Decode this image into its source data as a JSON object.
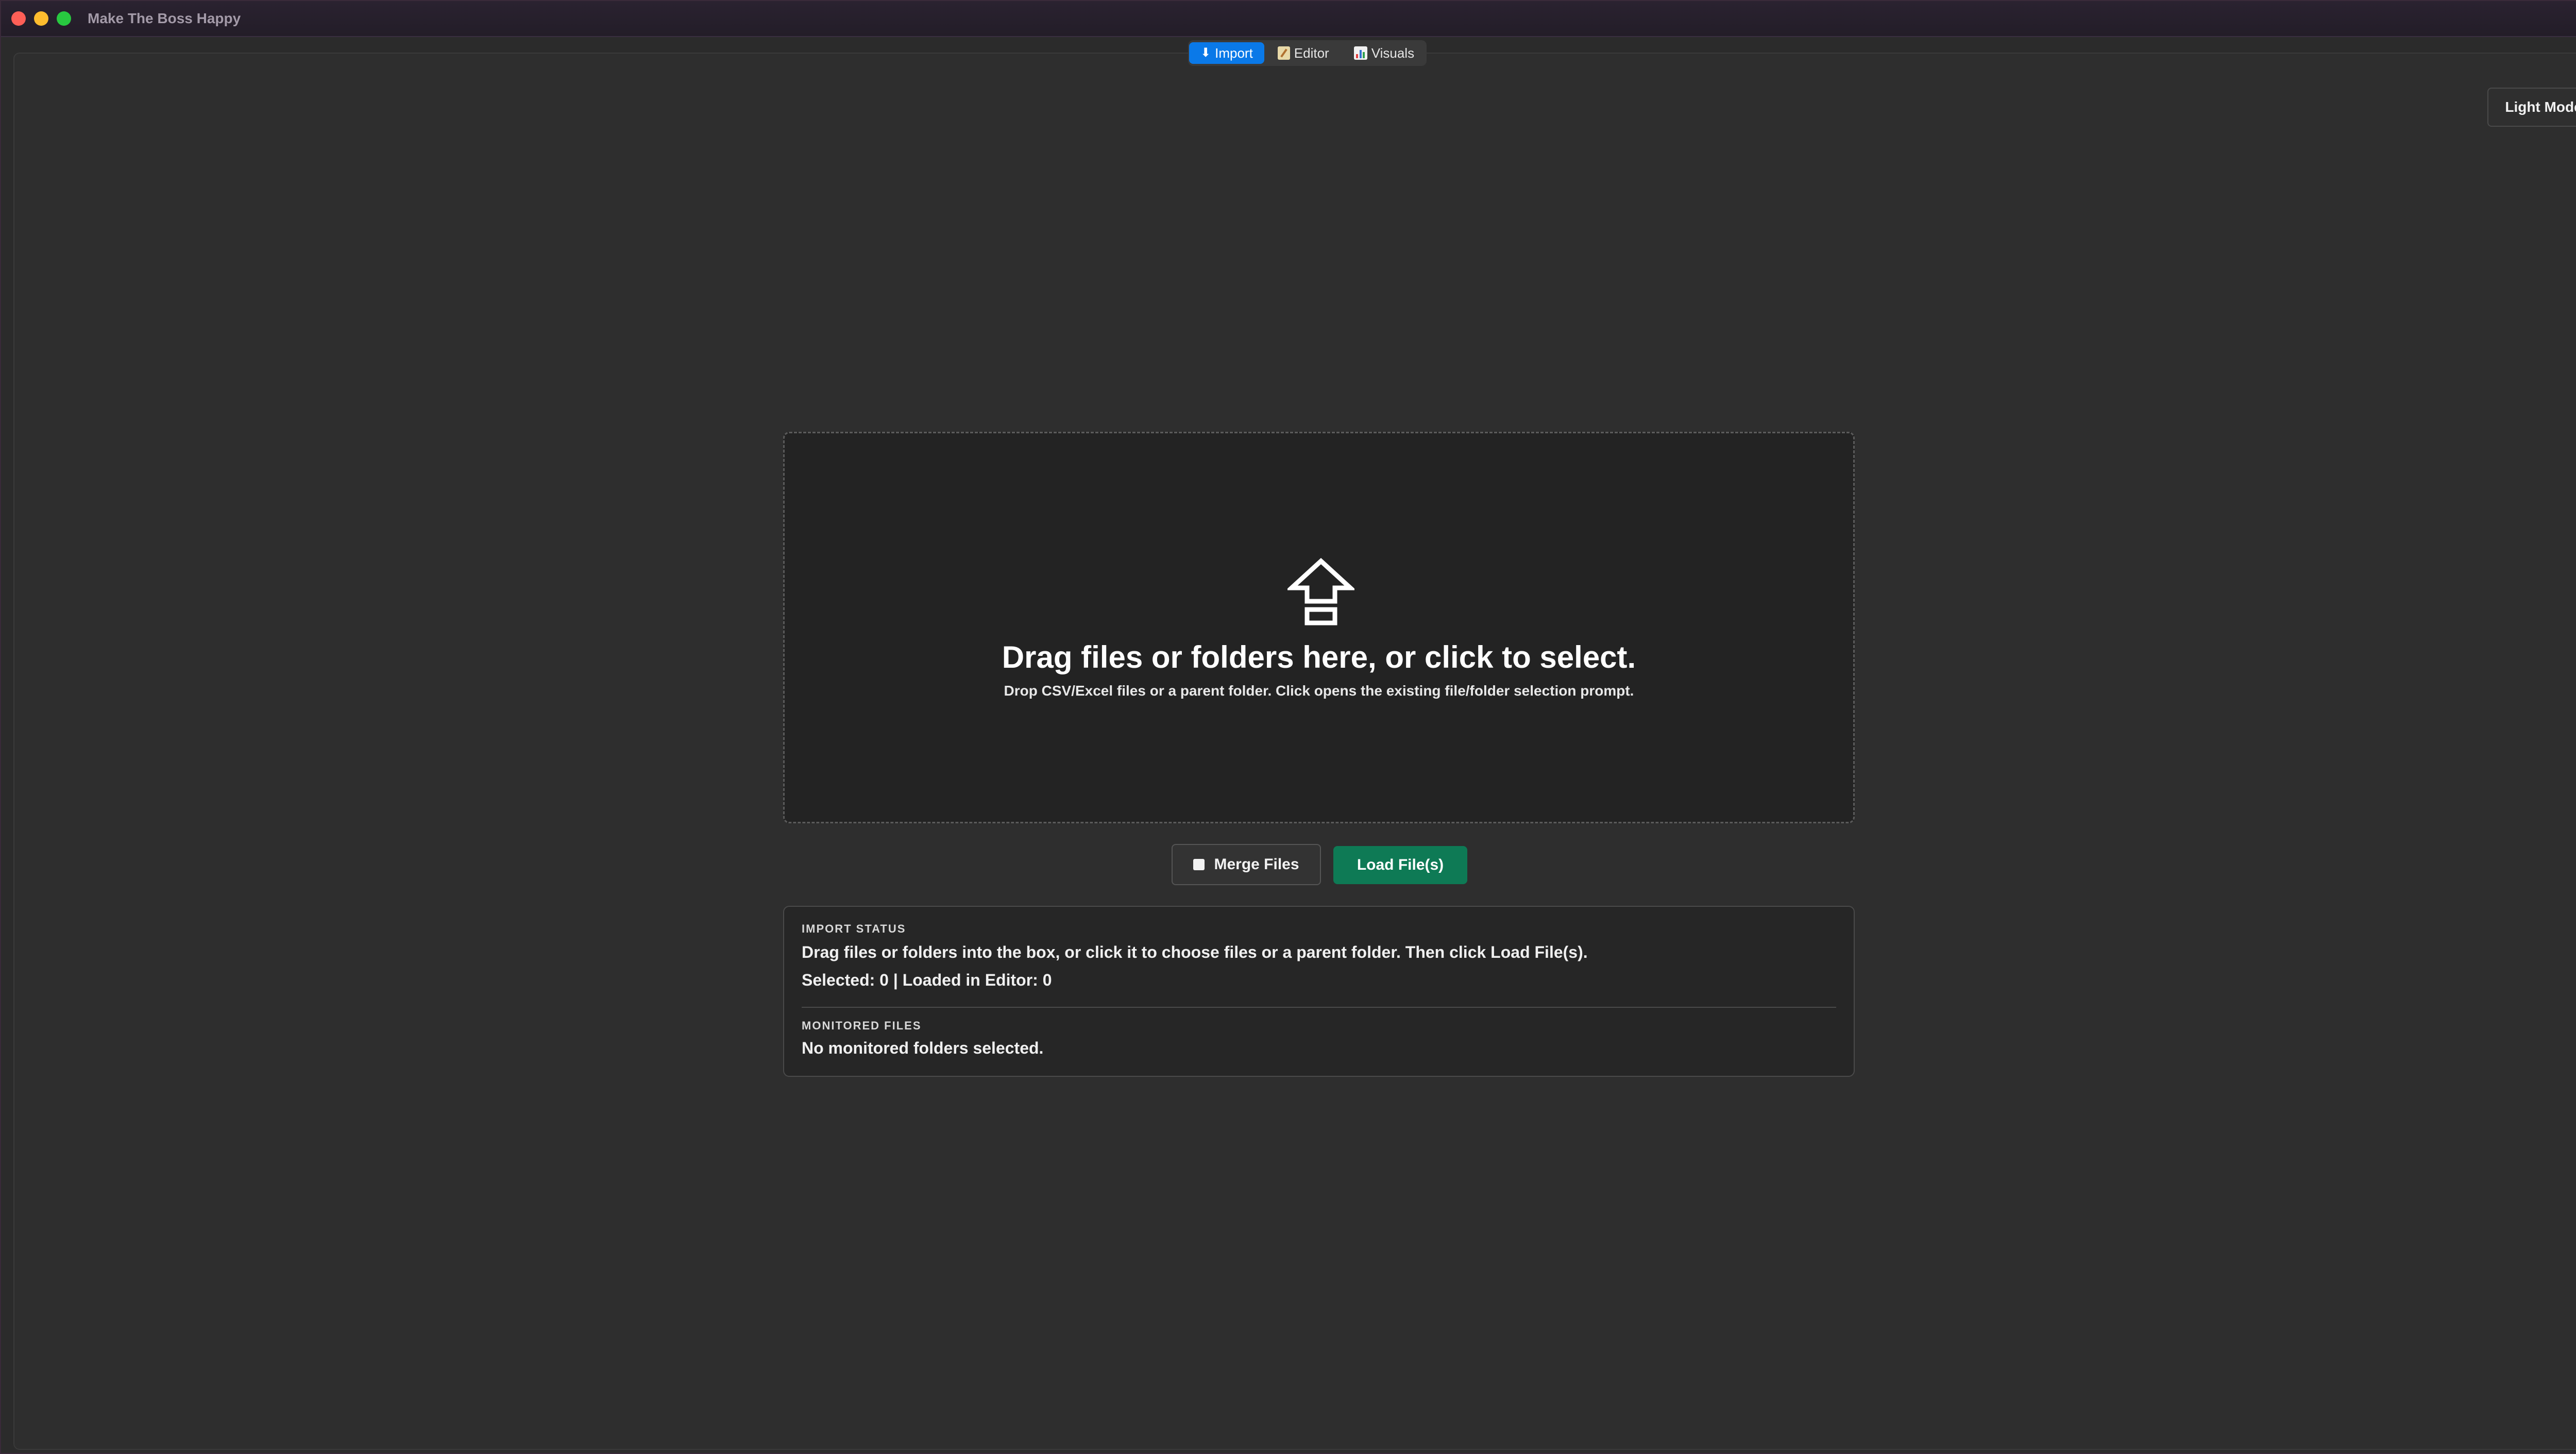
{
  "window": {
    "title": "Make The Boss Happy"
  },
  "tabs": [
    {
      "label": "Import",
      "icon": "download-arrow-icon",
      "active": true
    },
    {
      "label": "Editor",
      "icon": "memo-icon",
      "active": false
    },
    {
      "label": "Visuals",
      "icon": "bar-chart-icon",
      "active": false
    }
  ],
  "theme_toggle": {
    "label": "Light Mode"
  },
  "dropzone": {
    "icon": "upload-arrow-icon",
    "title": "Drag files or folders here, or click to select.",
    "subtitle": "Drop CSV/Excel files or a parent folder. Click opens the existing file/folder selection prompt."
  },
  "actions": {
    "merge_label": "Merge Files",
    "merge_checked": false,
    "load_label": "Load File(s)"
  },
  "import_status": {
    "heading": "IMPORT STATUS",
    "message": "Drag files or folders into the box, or click it to choose files or a parent folder. Then click Load File(s).",
    "counts": "Selected: 0 | Loaded in Editor: 0"
  },
  "monitored_files": {
    "heading": "MONITORED FILES",
    "message": "No monitored folders selected."
  },
  "colors": {
    "accent_blue": "#0a79e8",
    "load_green": "#0e7a55",
    "background": "#2e2e2e"
  }
}
